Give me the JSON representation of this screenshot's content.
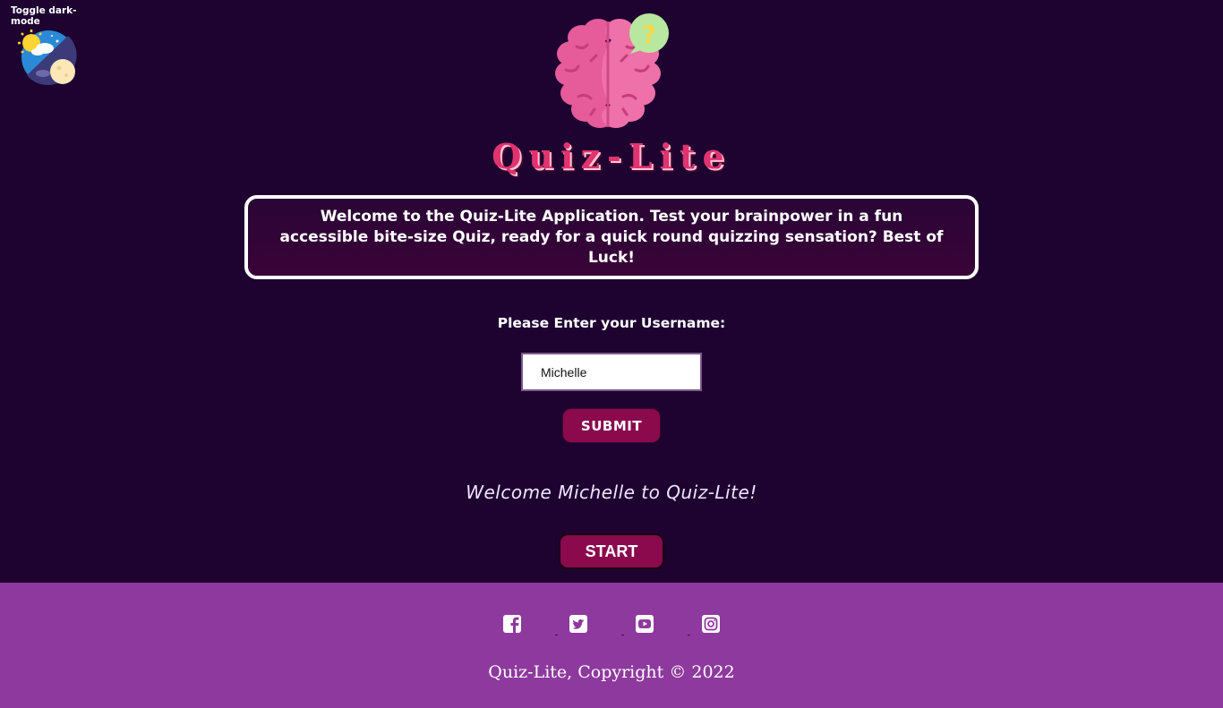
{
  "toggle": {
    "label": "Toggle dark-mode",
    "icon": "day-night-icon"
  },
  "logo": {
    "icon": "brain-question-icon"
  },
  "title": "Quiz-Lite",
  "welcome_box": {
    "text": "Welcome to the Quiz-Lite Application. Test your brainpower in a fun accessible bite-size Quiz, ready for a quick round quizzing sensation? Best of Luck!"
  },
  "username": {
    "label": "Please Enter your Username:",
    "value": "Michelle"
  },
  "buttons": {
    "submit": "SUBMIT",
    "start": "START"
  },
  "greeting": "Welcome Michelle to Quiz-Lite!",
  "footer": {
    "socials": [
      "facebook-icon",
      "twitter-icon",
      "youtube-icon",
      "instagram-icon"
    ],
    "copyright": "Quiz-Lite, Copyright © 2022"
  },
  "colors": {
    "background": "#1e0331",
    "title": "#e0336f",
    "button": "#8a0a4d",
    "footer": "#8e399d"
  }
}
